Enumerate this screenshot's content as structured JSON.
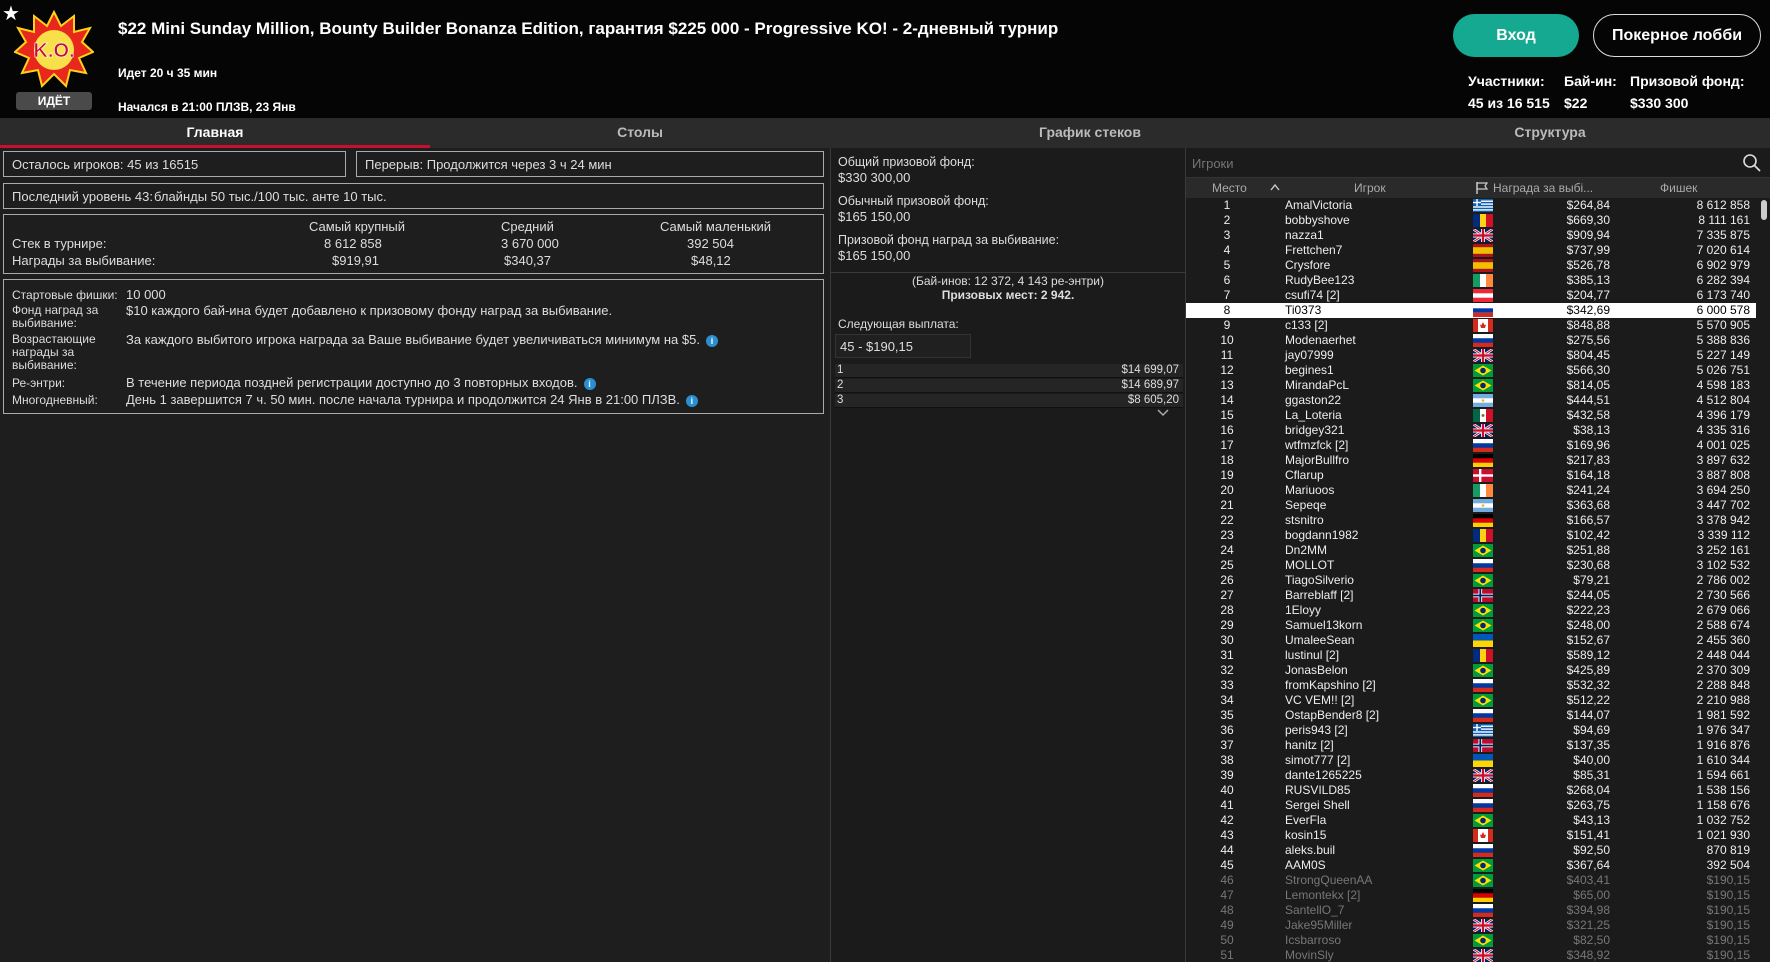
{
  "header": {
    "status": "ИДЁТ",
    "title": "$22 Mini Sunday Million, Bounty Builder Bonanza Edition, гарантия $225 000 - Progressive KO! - 2-дневный турнир",
    "running": "Идет 20 ч 35 мин",
    "started": "Начался в 21:00 ПЛЗВ, 23 Янв",
    "login": "Вход",
    "lobby": "Покерное лобби",
    "players_label": "Участники:",
    "players_value": "45 из 16 515",
    "buyin_label": "Бай-ин:",
    "buyin_value": "$22",
    "prize_label": "Призовой фонд:",
    "prize_value": "$330 300",
    "logo_text": "K.O."
  },
  "tabs": [
    "Главная",
    "Столы",
    "График стеков",
    "Структура"
  ],
  "main": {
    "remaining": "Осталось игроков: 45 из 16515",
    "break": "Перерыв: Продолжится через 3 ч 24 мин",
    "last_level_label": "Последний уровень 43:",
    "last_level_value": "блайнды 50 тыс./100 тыс. анте 10 тыс.",
    "stats": {
      "col_largest": "Самый крупный",
      "col_average": "Средний",
      "col_smallest": "Самый маленький",
      "row_stack": "Стек в турнире:",
      "row_bounty": "Награды за выбивание:",
      "stack": [
        "8 612 858",
        "3 670 000",
        "392 504"
      ],
      "bounty": [
        "$919,91",
        "$340,37",
        "$48,12"
      ]
    },
    "info": {
      "start_chips_label": "Стартовые фишки:",
      "start_chips_value": "10 000",
      "bounty_fund_label": "Фонд наград за выбивание:",
      "bounty_fund_value": "$10 каждого бай-ина будет добавлено к призовому фонду наград за выбивание.",
      "increasing_label": "Возрастающие награды за выбивание:",
      "increasing_value": "За каждого выбитого игрока награда за Ваше выбивание будет увеличиваться минимум на $5.",
      "reentry_label": "Ре-энтри:",
      "reentry_value": "В течение периода поздней регистрации доступно до 3 повторных входов.",
      "multiday_label": "Многодневный:",
      "multiday_value": "День 1 завершится 7 ч. 50 мин. после начала турнира и продолжится 24 Янв в 21:00 ПЛЗВ."
    }
  },
  "prizes": {
    "total_label": "Общий призовой фонд:",
    "total_value": "$330 300,00",
    "regular_label": "Обычный призовой фонд:",
    "regular_value": "$165 150,00",
    "bounty_label": "Призовой фонд наград за выбивание:",
    "bounty_value": "$165 150,00",
    "buyins": "(Бай-инов: 12 372, 4 143 ре-энтри)",
    "paid": "Призовых мест: 2 942.",
    "next_label": "Следующая выплата:",
    "next_value": "45 - $190,15",
    "payouts": [
      {
        "place": "1",
        "amount": "$14 699,07"
      },
      {
        "place": "2",
        "amount": "$14 689,97"
      },
      {
        "place": "3",
        "amount": "$8 605,20"
      }
    ]
  },
  "players": {
    "search_placeholder": "Игроки",
    "col_place": "Место",
    "col_player": "Игрок",
    "col_bounty": "Награда за выбі...",
    "col_chips": "Фишек",
    "rows": [
      [
        "1",
        "AmalVictoria",
        "$264,84",
        "8 612 858",
        "gr"
      ],
      [
        "2",
        "bobbyshove",
        "$669,30",
        "8 111 161",
        "ro"
      ],
      [
        "3",
        "nazza1",
        "$909,94",
        "7 335 875",
        "gb"
      ],
      [
        "4",
        "Frettchen7",
        "$737,99",
        "7 020 614",
        "es"
      ],
      [
        "5",
        "Crysfore",
        "$526,78",
        "6 902 979",
        "es"
      ],
      [
        "6",
        "RudyBee123",
        "$385,13",
        "6 282 394",
        "ie"
      ],
      [
        "7",
        "csufi74 [2]",
        "$204,77",
        "6 173 740",
        "at"
      ],
      [
        "8",
        "Ti0373",
        "$342,69",
        "6 000 578",
        "ru"
      ],
      [
        "9",
        "c133 [2]",
        "$848,88",
        "5 570 905",
        "ca"
      ],
      [
        "10",
        "Modenaerhet",
        "$275,56",
        "5 388 836",
        "ru"
      ],
      [
        "11",
        "jay07999",
        "$804,45",
        "5 227 149",
        "gb"
      ],
      [
        "12",
        "begines1",
        "$566,30",
        "5 026 751",
        "br"
      ],
      [
        "13",
        "MirandaPcL",
        "$814,05",
        "4 598 183",
        "br"
      ],
      [
        "14",
        "ggaston22",
        "$444,51",
        "4 512 804",
        "ar"
      ],
      [
        "15",
        "La_Loteria",
        "$432,58",
        "4 396 179",
        "mx"
      ],
      [
        "16",
        "bridgey321",
        "$38,13",
        "4 335 316",
        "gb"
      ],
      [
        "17",
        "wtfmzfck [2]",
        "$169,96",
        "4 001 025",
        "ru"
      ],
      [
        "18",
        "MajorBullfro",
        "$217,83",
        "3 897 632",
        "de"
      ],
      [
        "19",
        "Cflarup",
        "$164,18",
        "3 887 808",
        "dk"
      ],
      [
        "20",
        "Mariuoos",
        "$241,24",
        "3 694 250",
        "ie"
      ],
      [
        "21",
        "Sepeqe",
        "$363,68",
        "3 447 702",
        "ar"
      ],
      [
        "22",
        "stsnitro",
        "$166,57",
        "3 378 942",
        "de"
      ],
      [
        "23",
        "bogdann1982",
        "$102,42",
        "3 339 112",
        "ro"
      ],
      [
        "24",
        "Dn2MM",
        "$251,88",
        "3 252 161",
        "br"
      ],
      [
        "25",
        "MOLLOT",
        "$230,68",
        "3 102 532",
        "ru"
      ],
      [
        "26",
        "TiagoSilverio",
        "$79,21",
        "2 786 002",
        "br"
      ],
      [
        "27",
        "Barreblaff [2]",
        "$244,05",
        "2 730 566",
        "no"
      ],
      [
        "28",
        "1Eloyy",
        "$222,23",
        "2 679 066",
        "br"
      ],
      [
        "29",
        "Samuel13korn",
        "$248,00",
        "2 588 674",
        "br"
      ],
      [
        "30",
        "UmaleeSean",
        "$152,67",
        "2 455 360",
        "ua"
      ],
      [
        "31",
        "lustinul [2]",
        "$589,12",
        "2 448 044",
        "ro"
      ],
      [
        "32",
        "JonasBelon",
        "$425,89",
        "2 370 309",
        "br"
      ],
      [
        "33",
        "fromKapshino [2]",
        "$532,32",
        "2 288 848",
        "ru"
      ],
      [
        "34",
        "VC VEM!! [2]",
        "$512,22",
        "2 210 988",
        "br"
      ],
      [
        "35",
        "OstapBender8 [2]",
        "$144,07",
        "1 981 592",
        "ru"
      ],
      [
        "36",
        "peris943 [2]",
        "$94,69",
        "1 976 347",
        "gr"
      ],
      [
        "37",
        "hanitz [2]",
        "$137,35",
        "1 916 876",
        "no"
      ],
      [
        "38",
        "simot777 [2]",
        "$40,00",
        "1 610 344",
        "ua"
      ],
      [
        "39",
        "dante1265225",
        "$85,31",
        "1 594 661",
        "gb"
      ],
      [
        "40",
        "RUSVILD85",
        "$268,04",
        "1 538 156",
        "ru"
      ],
      [
        "41",
        "Sergei Shell",
        "$263,75",
        "1 158 676",
        "ru"
      ],
      [
        "42",
        "EverFla",
        "$43,13",
        "1 032 752",
        "br"
      ],
      [
        "43",
        "kosin15",
        "$151,41",
        "1 021 930",
        "ca"
      ],
      [
        "44",
        "aleks.buil",
        "$92,50",
        "870 819",
        "ru"
      ],
      [
        "45",
        "AAM0S",
        "$367,64",
        "392 504",
        "br"
      ],
      [
        "46",
        "StrongQueenAA",
        "$403,41",
        "$190,15",
        "br"
      ],
      [
        "47",
        "Lemontekx [2]",
        "$65,00",
        "$190,15",
        "de"
      ],
      [
        "48",
        "SantellO_7",
        "$394,98",
        "$190,15",
        "ru"
      ],
      [
        "49",
        "Jake95Miller",
        "$321,25",
        "$190,15",
        "gb"
      ],
      [
        "50",
        "Icsbarroso",
        "$82,50",
        "$190,15",
        "br"
      ],
      [
        "51",
        "MovinSly",
        "$348,92",
        "$190,15",
        "gb"
      ]
    ]
  },
  "colors": {
    "accent_green": "#16a991",
    "tab_active": "#c8102e",
    "info_blue": "#2a8fd0"
  }
}
